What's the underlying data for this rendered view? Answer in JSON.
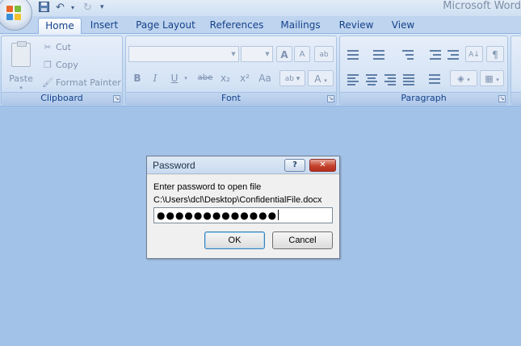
{
  "app": {
    "title": "Microsoft Word"
  },
  "quick_access": {
    "save_icon": "save-icon",
    "undo_icon": "undo-icon",
    "redo_icon": "redo-icon",
    "customize_icon": "customize-quick-access-icon"
  },
  "tabs": [
    {
      "label": "Home",
      "active": true
    },
    {
      "label": "Insert"
    },
    {
      "label": "Page Layout"
    },
    {
      "label": "References"
    },
    {
      "label": "Mailings"
    },
    {
      "label": "Review"
    },
    {
      "label": "View"
    }
  ],
  "ribbon": {
    "clipboard": {
      "label": "Clipboard",
      "paste": "Paste",
      "cut": "Cut",
      "copy": "Copy",
      "format_painter": "Format Painter"
    },
    "font": {
      "label": "Font",
      "font_name": "",
      "font_size": "",
      "grow": "A",
      "shrink": "A",
      "clear_format": "ab",
      "bold": "B",
      "italic": "I",
      "underline": "U",
      "strike": "abe",
      "subscript": "x₂",
      "superscript": "x²",
      "change_case": "Aa",
      "highlight": "ab",
      "font_color": "A"
    },
    "paragraph": {
      "label": "Paragraph",
      "sort": "A↓",
      "show_marks": "¶"
    }
  },
  "dialog": {
    "title": "Password",
    "help": "?",
    "close": "✕",
    "prompt": "Enter password to open file",
    "file_path": "C:\\Users\\dcl\\Desktop\\ConfidentialFile.docx",
    "password_masked": "●●●●●●●●●●●●●",
    "ok": "OK",
    "cancel": "Cancel"
  },
  "colors": {
    "ribbon_text": "#15428b",
    "workspace": "#a3c2e8",
    "close_button": "#c4412b"
  }
}
